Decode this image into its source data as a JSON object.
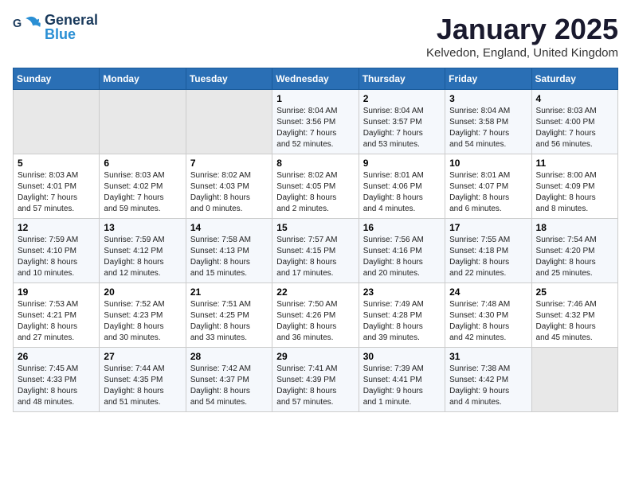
{
  "header": {
    "logo_general": "General",
    "logo_blue": "Blue",
    "month": "January 2025",
    "location": "Kelvedon, England, United Kingdom"
  },
  "weekdays": [
    "Sunday",
    "Monday",
    "Tuesday",
    "Wednesday",
    "Thursday",
    "Friday",
    "Saturday"
  ],
  "weeks": [
    [
      {
        "num": "",
        "info": ""
      },
      {
        "num": "",
        "info": ""
      },
      {
        "num": "",
        "info": ""
      },
      {
        "num": "1",
        "info": "Sunrise: 8:04 AM\nSunset: 3:56 PM\nDaylight: 7 hours\nand 52 minutes."
      },
      {
        "num": "2",
        "info": "Sunrise: 8:04 AM\nSunset: 3:57 PM\nDaylight: 7 hours\nand 53 minutes."
      },
      {
        "num": "3",
        "info": "Sunrise: 8:04 AM\nSunset: 3:58 PM\nDaylight: 7 hours\nand 54 minutes."
      },
      {
        "num": "4",
        "info": "Sunrise: 8:03 AM\nSunset: 4:00 PM\nDaylight: 7 hours\nand 56 minutes."
      }
    ],
    [
      {
        "num": "5",
        "info": "Sunrise: 8:03 AM\nSunset: 4:01 PM\nDaylight: 7 hours\nand 57 minutes."
      },
      {
        "num": "6",
        "info": "Sunrise: 8:03 AM\nSunset: 4:02 PM\nDaylight: 7 hours\nand 59 minutes."
      },
      {
        "num": "7",
        "info": "Sunrise: 8:02 AM\nSunset: 4:03 PM\nDaylight: 8 hours\nand 0 minutes."
      },
      {
        "num": "8",
        "info": "Sunrise: 8:02 AM\nSunset: 4:05 PM\nDaylight: 8 hours\nand 2 minutes."
      },
      {
        "num": "9",
        "info": "Sunrise: 8:01 AM\nSunset: 4:06 PM\nDaylight: 8 hours\nand 4 minutes."
      },
      {
        "num": "10",
        "info": "Sunrise: 8:01 AM\nSunset: 4:07 PM\nDaylight: 8 hours\nand 6 minutes."
      },
      {
        "num": "11",
        "info": "Sunrise: 8:00 AM\nSunset: 4:09 PM\nDaylight: 8 hours\nand 8 minutes."
      }
    ],
    [
      {
        "num": "12",
        "info": "Sunrise: 7:59 AM\nSunset: 4:10 PM\nDaylight: 8 hours\nand 10 minutes."
      },
      {
        "num": "13",
        "info": "Sunrise: 7:59 AM\nSunset: 4:12 PM\nDaylight: 8 hours\nand 12 minutes."
      },
      {
        "num": "14",
        "info": "Sunrise: 7:58 AM\nSunset: 4:13 PM\nDaylight: 8 hours\nand 15 minutes."
      },
      {
        "num": "15",
        "info": "Sunrise: 7:57 AM\nSunset: 4:15 PM\nDaylight: 8 hours\nand 17 minutes."
      },
      {
        "num": "16",
        "info": "Sunrise: 7:56 AM\nSunset: 4:16 PM\nDaylight: 8 hours\nand 20 minutes."
      },
      {
        "num": "17",
        "info": "Sunrise: 7:55 AM\nSunset: 4:18 PM\nDaylight: 8 hours\nand 22 minutes."
      },
      {
        "num": "18",
        "info": "Sunrise: 7:54 AM\nSunset: 4:20 PM\nDaylight: 8 hours\nand 25 minutes."
      }
    ],
    [
      {
        "num": "19",
        "info": "Sunrise: 7:53 AM\nSunset: 4:21 PM\nDaylight: 8 hours\nand 27 minutes."
      },
      {
        "num": "20",
        "info": "Sunrise: 7:52 AM\nSunset: 4:23 PM\nDaylight: 8 hours\nand 30 minutes."
      },
      {
        "num": "21",
        "info": "Sunrise: 7:51 AM\nSunset: 4:25 PM\nDaylight: 8 hours\nand 33 minutes."
      },
      {
        "num": "22",
        "info": "Sunrise: 7:50 AM\nSunset: 4:26 PM\nDaylight: 8 hours\nand 36 minutes."
      },
      {
        "num": "23",
        "info": "Sunrise: 7:49 AM\nSunset: 4:28 PM\nDaylight: 8 hours\nand 39 minutes."
      },
      {
        "num": "24",
        "info": "Sunrise: 7:48 AM\nSunset: 4:30 PM\nDaylight: 8 hours\nand 42 minutes."
      },
      {
        "num": "25",
        "info": "Sunrise: 7:46 AM\nSunset: 4:32 PM\nDaylight: 8 hours\nand 45 minutes."
      }
    ],
    [
      {
        "num": "26",
        "info": "Sunrise: 7:45 AM\nSunset: 4:33 PM\nDaylight: 8 hours\nand 48 minutes."
      },
      {
        "num": "27",
        "info": "Sunrise: 7:44 AM\nSunset: 4:35 PM\nDaylight: 8 hours\nand 51 minutes."
      },
      {
        "num": "28",
        "info": "Sunrise: 7:42 AM\nSunset: 4:37 PM\nDaylight: 8 hours\nand 54 minutes."
      },
      {
        "num": "29",
        "info": "Sunrise: 7:41 AM\nSunset: 4:39 PM\nDaylight: 8 hours\nand 57 minutes."
      },
      {
        "num": "30",
        "info": "Sunrise: 7:39 AM\nSunset: 4:41 PM\nDaylight: 9 hours\nand 1 minute."
      },
      {
        "num": "31",
        "info": "Sunrise: 7:38 AM\nSunset: 4:42 PM\nDaylight: 9 hours\nand 4 minutes."
      },
      {
        "num": "",
        "info": ""
      }
    ]
  ],
  "empty_weeks": [
    [
      0,
      1,
      2
    ],
    [
      4,
      6
    ]
  ],
  "week5_empty": [
    6
  ]
}
